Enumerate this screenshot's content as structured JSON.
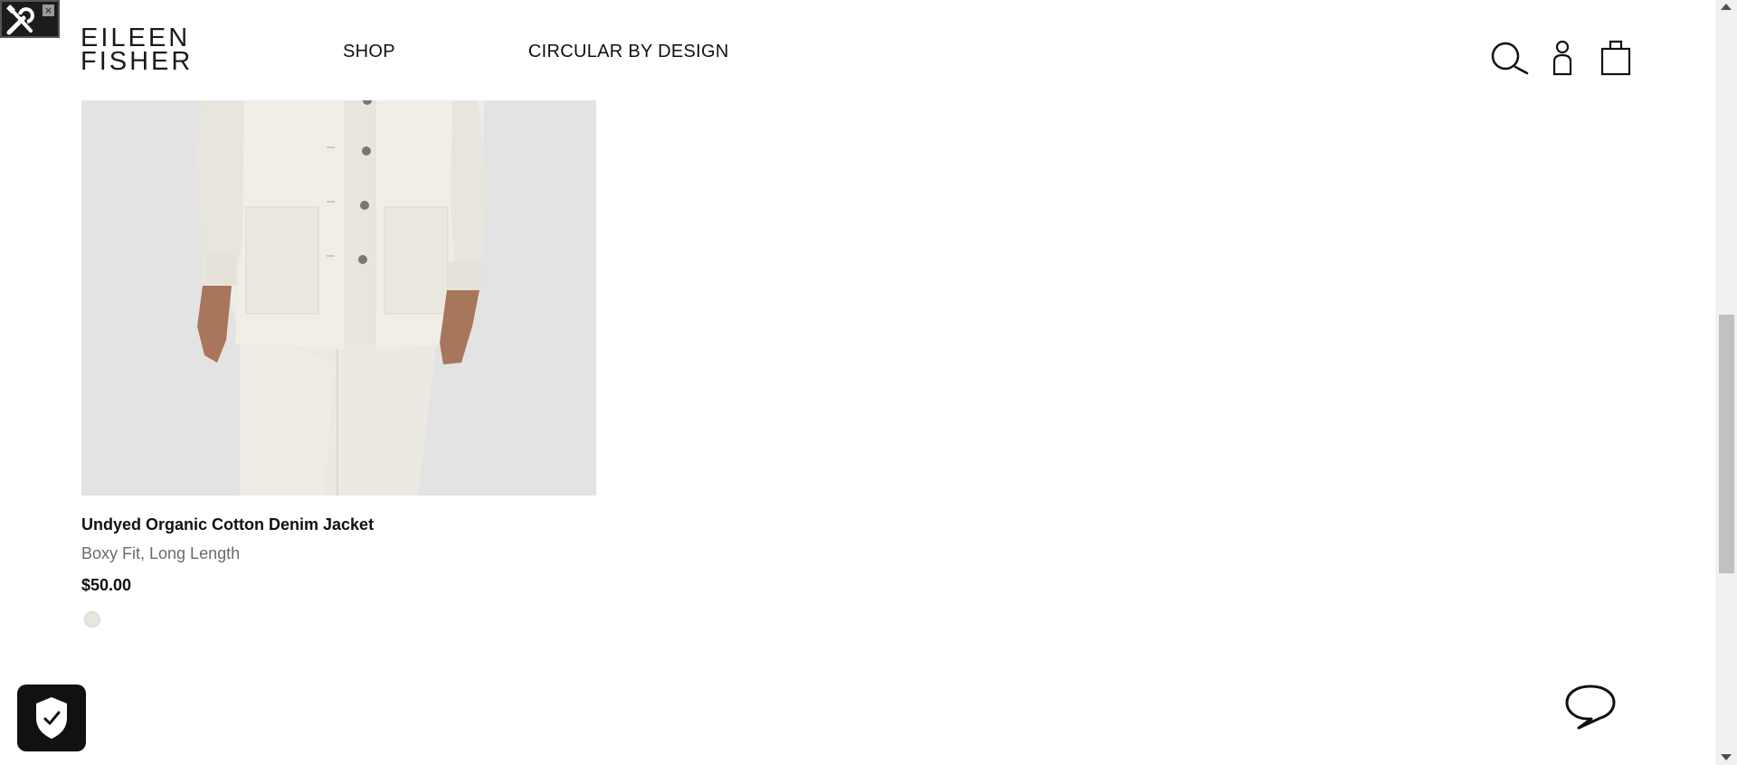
{
  "brand": {
    "line1": "EILEEN",
    "line2": "FISHER"
  },
  "nav": [
    {
      "label": "SHOP"
    },
    {
      "label": "CIRCULAR BY DESIGN"
    }
  ],
  "header_icons": [
    "search-icon",
    "account-icon",
    "shopping-bag-icon"
  ],
  "product": {
    "name": "Undyed Organic Cotton Denim Jacket",
    "subtitle": "Boxy Fit, Long Length",
    "price": "$50.00",
    "swatch_color": "#e7e5dc"
  },
  "overlays": {
    "devtools_icon": "tools-icon",
    "devtools_close": "×",
    "security_badge_icon": "shield-check-icon",
    "chat_icon": "chat-bubble-icon"
  }
}
